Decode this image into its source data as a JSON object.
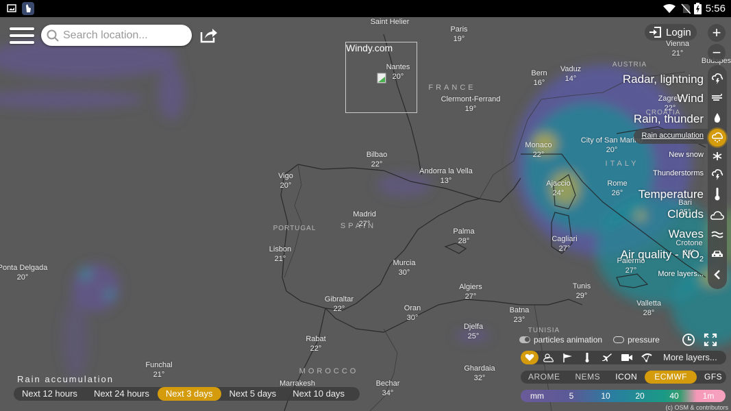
{
  "status_bar": {
    "time": "5:56",
    "icons": [
      "gallery-icon",
      "gesture-app-icon",
      "wifi-icon",
      "no-sim-icon",
      "battery-charging-icon"
    ]
  },
  "top_bar": {
    "search_placeholder": "Search location...",
    "menu_icon": "hamburger-menu-icon",
    "share_icon": "share-icon",
    "login_label": "Login",
    "zoom_in": "+",
    "zoom_out": "−"
  },
  "overlay_box": {
    "title": "Windy.com"
  },
  "map": {
    "cities": [
      {
        "name": "Saint Helier",
        "temp": ""
      },
      {
        "name": "Paris",
        "temp": "19°"
      },
      {
        "name": "Nantes",
        "temp": "20°"
      },
      {
        "name": "Clermont-Ferrand",
        "temp": "19°"
      },
      {
        "name": "Bern",
        "temp": "16°"
      },
      {
        "name": "Vaduz",
        "temp": "14°"
      },
      {
        "name": "Vienna",
        "temp": "21°"
      },
      {
        "name": "Budapest",
        "temp": ""
      },
      {
        "name": "Zagreb",
        "temp": "22°"
      },
      {
        "name": "Monaco",
        "temp": "22°"
      },
      {
        "name": "City of San Marino",
        "temp": "20°"
      },
      {
        "name": "Bilbao",
        "temp": "22°"
      },
      {
        "name": "Andorra la Vella",
        "temp": "13°"
      },
      {
        "name": "Vigo",
        "temp": "20°"
      },
      {
        "name": "Ajaccio",
        "temp": "24°"
      },
      {
        "name": "Rome",
        "temp": "26°"
      },
      {
        "name": "Madrid",
        "temp": "27°"
      },
      {
        "name": "Palma",
        "temp": "28°"
      },
      {
        "name": "Lisbon",
        "temp": "21°"
      },
      {
        "name": "Cagliari",
        "temp": "27°"
      },
      {
        "name": "Ponta Delgada",
        "temp": "20°"
      },
      {
        "name": "Murcia",
        "temp": "30°"
      },
      {
        "name": "Palermo",
        "temp": "27°"
      },
      {
        "name": "Algiers",
        "temp": "27°"
      },
      {
        "name": "Tunis",
        "temp": "29°"
      },
      {
        "name": "Gibraltar",
        "temp": "22°"
      },
      {
        "name": "Oran",
        "temp": "30°"
      },
      {
        "name": "Valletta",
        "temp": "28°"
      },
      {
        "name": "Batna",
        "temp": "23°"
      },
      {
        "name": "Djelfa",
        "temp": "25°"
      },
      {
        "name": "Rabat",
        "temp": "22°"
      },
      {
        "name": "Funchal",
        "temp": "21°"
      },
      {
        "name": "Ghardaia",
        "temp": "32°"
      },
      {
        "name": "Marrakesh",
        "temp": ""
      },
      {
        "name": "Bechar",
        "temp": "34°"
      },
      {
        "name": "Bari",
        "temp": "25°"
      },
      {
        "name": "Crotone",
        "temp": "24°"
      }
    ],
    "countries": [
      "FRANCE",
      "SPAIN",
      "PORTUGAL",
      "ITALY",
      "AUSTRIA",
      "CROATIA",
      "MOROCCO",
      "TUNISIA"
    ]
  },
  "layer_menu": {
    "items": [
      {
        "label": "Radar, lightning",
        "icon": "radar-lightning-icon"
      },
      {
        "label": "Wind",
        "icon": "wind-icon"
      },
      {
        "label": "Rain, thunder",
        "icon": "raindrop-icon"
      },
      {
        "label": "Rain accumulation",
        "icon": "rain-accumulation-icon",
        "active": true
      },
      {
        "label": "New snow",
        "icon": "snowflake-icon"
      },
      {
        "label": "Thunderstorms",
        "icon": "thunderstorm-icon"
      },
      {
        "label": "Temperature",
        "icon": "thermometer-icon"
      },
      {
        "label": "Clouds",
        "icon": "cloud-icon"
      },
      {
        "label": "Waves",
        "icon": "waves-icon"
      },
      {
        "label": "Air quality - NO",
        "subscript": "2",
        "icon": "car-icon"
      },
      {
        "label": "More layers...",
        "icon": "chevron-left-icon"
      }
    ]
  },
  "product": {
    "title": "Rain accumulation",
    "time_ranges": [
      "Next 12 hours",
      "Next 24 hours",
      "Next 3 days",
      "Next 5 days",
      "Next 10 days"
    ],
    "selected_time_range": "Next 3 days"
  },
  "overlays_toggles": {
    "particles_label": "particles animation",
    "particles_on": true,
    "pressure_label": "pressure",
    "pressure_on": false
  },
  "quick_bar": {
    "icons": [
      "heart-icon",
      "sun-cloud-icon",
      "windsock-icon",
      "thermometer-icon",
      "airplane-icon",
      "webcam-icon",
      "paraglider-icon"
    ],
    "more_label": "More layers..."
  },
  "models": {
    "items": [
      "AROME",
      "NEMS",
      "ICON",
      "ECMWF",
      "GFS"
    ],
    "selected": "ECMWF"
  },
  "legend": {
    "unit": "mm",
    "stops": [
      "5",
      "10",
      "20",
      "40",
      "1m"
    ],
    "colors": [
      "#6a5b99",
      "#2a7ea0",
      "#1a9a85",
      "#3a9c70",
      "#f598b8"
    ]
  },
  "attribution": "(c) OSM & contributors",
  "accent_color": "#d49b0c"
}
